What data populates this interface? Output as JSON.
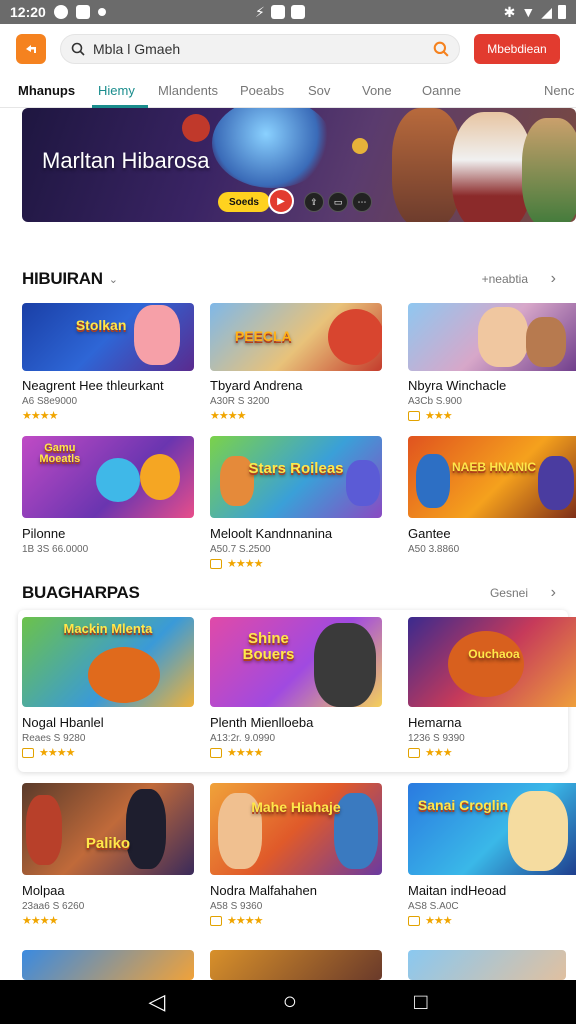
{
  "status": {
    "time": "12:20"
  },
  "search": {
    "query": "Mbla l Gmaeh"
  },
  "header": {
    "cta_label": "Mbebdiean"
  },
  "tabs": [
    {
      "label": "Mhanups"
    },
    {
      "label": "Hiemy"
    },
    {
      "label": "Mlandents"
    },
    {
      "label": "Poeabs"
    },
    {
      "label": "Sov"
    },
    {
      "label": "Vone"
    },
    {
      "label": "Oanne"
    },
    {
      "label": "Nenc"
    }
  ],
  "hero": {
    "title": "Marltan Hibarosa",
    "badge": "Soeds"
  },
  "sections": [
    {
      "title": "HIBUIRAN",
      "more": "+neabtia",
      "cards": [
        {
          "title": "Neagrent Hee thleurkant",
          "sub": "A6 S8e9000",
          "logo": "Stolkan",
          "rating_icon": "none"
        },
        {
          "title": "Tbyard Andrena",
          "sub": "A30R S 3200",
          "logo": "PEECLA",
          "rating_icon": "none"
        },
        {
          "title": "Nbyra Winchacle",
          "sub": "A3Cb S.900",
          "logo": "",
          "rating_icon": "box"
        },
        {
          "title": "Pilonne",
          "sub": "1B 3S 66.0000",
          "logo": "Gamu Moeatls",
          "rating_icon": "hidden"
        },
        {
          "title": "Meloolt Kandnnanina",
          "sub": "A50.7 S.2500",
          "logo": "Stars Roileas",
          "rating_icon": "box"
        },
        {
          "title": "Gantee",
          "sub": "A50 3.8860",
          "logo": "NAEB HNANIC",
          "rating_icon": "hidden"
        }
      ]
    },
    {
      "title": "BUAGHARPAS",
      "more": "Gesnei",
      "cards": [
        {
          "title": "Nogal Hbanlel",
          "sub": "Reaes S 9280",
          "logo": "Mackin Mlenta",
          "rating_icon": "box"
        },
        {
          "title": "Plenth Mienlloeba",
          "sub": "A13:2r. 9.0990",
          "logo": "Shine Bouers",
          "rating_icon": "box"
        },
        {
          "title": "Hemarna",
          "sub": "1236 S 9390",
          "logo": "Ouchaoa",
          "rating_icon": "box"
        },
        {
          "title": "Molpaa",
          "sub": "23aa6 S 6260",
          "logo": "Paliko",
          "rating_icon": "none"
        },
        {
          "title": "Nodra Malfahahen",
          "sub": "A58 S 9360",
          "logo": "Mahe Hiahaje",
          "rating_icon": "box"
        },
        {
          "title": "Maitan indHeoad",
          "sub": "AS8 S.A0C",
          "logo": "Sanai Croglin",
          "rating_icon": "box"
        }
      ]
    }
  ],
  "stars_text": "★★★★",
  "nav": {
    "back": "◁",
    "home": "○",
    "recents": "□"
  }
}
